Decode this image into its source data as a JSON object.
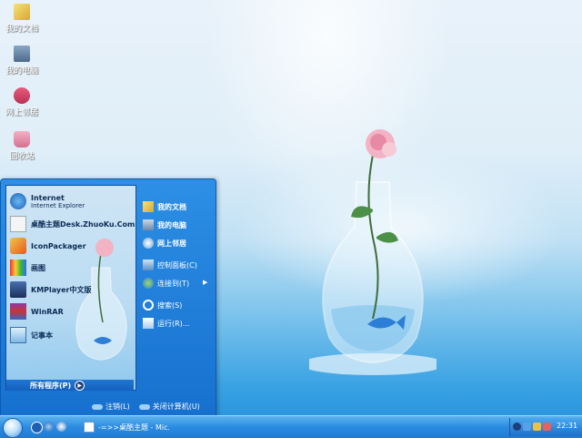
{
  "desktop": {
    "icons": [
      {
        "label": "我的文档",
        "icon": "my-documents-icon"
      },
      {
        "label": "我的电脑",
        "icon": "my-computer-icon"
      },
      {
        "label": "网上邻居",
        "icon": "network-icon"
      },
      {
        "label": "回收站",
        "icon": "recycle-bin-icon"
      }
    ]
  },
  "start_menu": {
    "pinned": [
      {
        "label": "Internet",
        "sublabel": "Internet Explorer",
        "icon": "internet-explorer-icon"
      },
      {
        "label": "桌酷主题Desk.ZhuoKu.Com",
        "icon": "zhuoku-icon"
      },
      {
        "label": "IconPackager",
        "icon": "iconpackager-icon"
      },
      {
        "label": "画图",
        "icon": "paint-icon"
      },
      {
        "label": "KMPlayer中文版",
        "icon": "kmplayer-icon"
      },
      {
        "label": "WinRAR",
        "icon": "winrar-icon"
      },
      {
        "label": "记事本",
        "icon": "notepad-icon"
      }
    ],
    "all_programs": "所有程序(P)",
    "right": [
      {
        "label": "我的文档",
        "icon": "my-documents-icon"
      },
      {
        "label": "我的电脑",
        "icon": "my-computer-icon"
      },
      {
        "label": "网上邻居",
        "icon": "network-icon"
      },
      {
        "label": "控制面板(C)",
        "icon": "control-panel-icon"
      },
      {
        "label": "连接到(T)",
        "icon": "connect-icon"
      },
      {
        "label": "搜索(S)",
        "icon": "search-icon"
      },
      {
        "label": "运行(R)...",
        "icon": "run-icon"
      }
    ],
    "logoff": "注销(L)",
    "shutdown": "关闭计算机(U)"
  },
  "taskbar": {
    "task_label": "-=>>桌酷主题 - Mic...",
    "clock": "22:31"
  }
}
